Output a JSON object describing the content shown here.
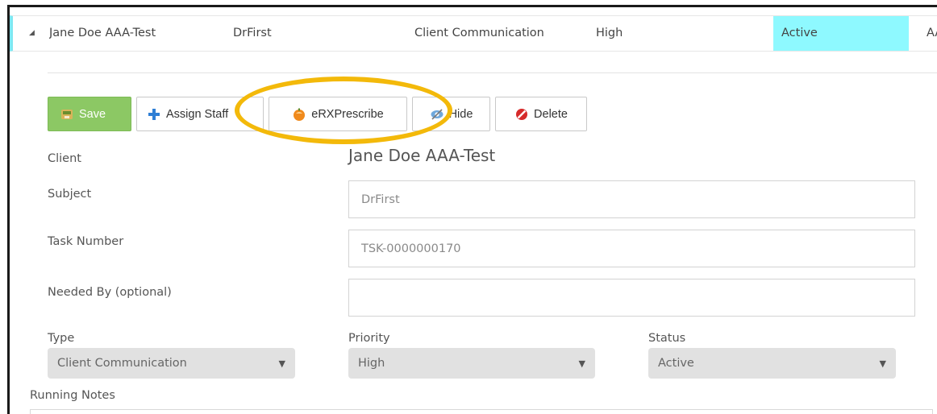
{
  "task_row": {
    "client": "Jane Doe AAA-Test",
    "subject": "DrFirst",
    "type": "Client Communication",
    "priority": "High",
    "status": "Active",
    "extra": "AAA",
    "expand_icon": "triangle-expanded-icon",
    "status_color": "#8ef9ff"
  },
  "toolbar": {
    "save_label": "Save",
    "assign_label": "Assign Staff",
    "erx_label": "eRXPrescribe",
    "hide_label": "Hide",
    "delete_label": "Delete",
    "save_color": "#8cc864"
  },
  "form": {
    "client_label": "Client",
    "client_value": "Jane Doe AAA-Test",
    "subject_label": "Subject",
    "subject_value": "DrFirst",
    "task_number_label": "Task Number",
    "task_number_value": "TSK-0000000170",
    "needed_by_label": "Needed By (optional)",
    "needed_by_value": "",
    "type_label": "Type",
    "type_value": "Client Communication",
    "priority_label": "Priority",
    "priority_value": "High",
    "status_label": "Status",
    "status_value": "Active",
    "running_notes_label": "Running Notes"
  },
  "annotation": {
    "highlight_color": "#f3b90a"
  }
}
